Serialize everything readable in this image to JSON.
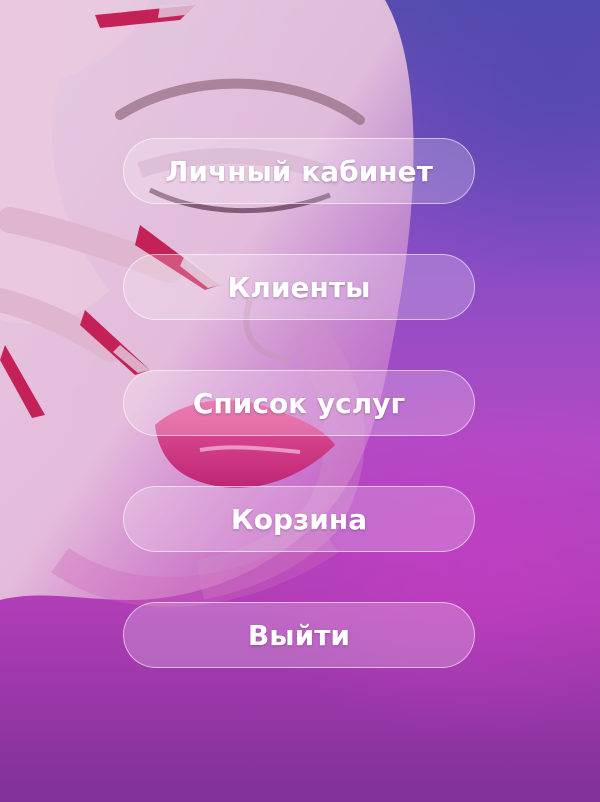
{
  "menu": {
    "items": [
      {
        "label": "Личный кабинет"
      },
      {
        "label": "Клиенты"
      },
      {
        "label": "Список услуг"
      },
      {
        "label": "Корзина"
      },
      {
        "label": "Выйти"
      }
    ]
  },
  "colors": {
    "background_top": "#4b4fae",
    "background_mid": "#b24cc8",
    "background_bottom": "#7a2f93",
    "button_fill": "rgba(255,255,255,0.22)",
    "button_text": "#ffffff",
    "lips": "#e0307a",
    "nails": "#c81e48"
  }
}
